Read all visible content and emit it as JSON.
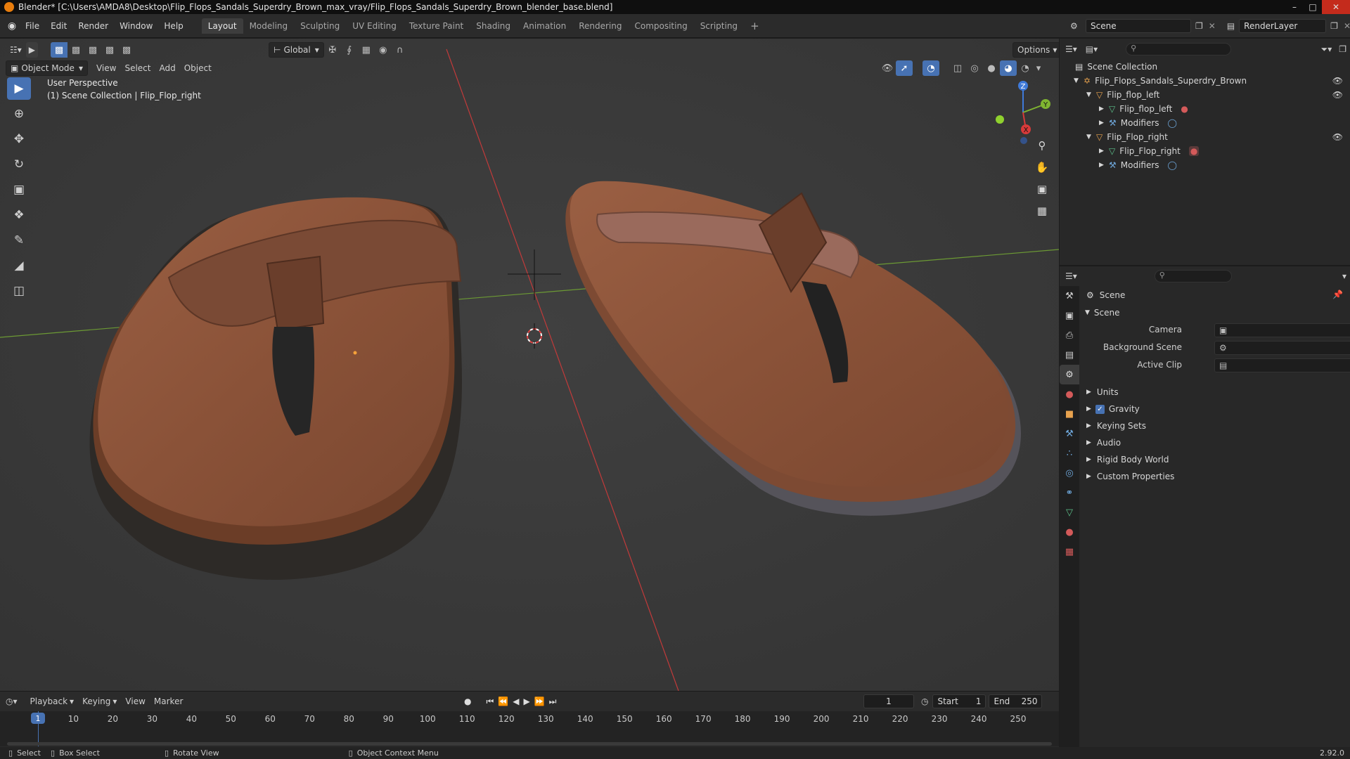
{
  "titlebar": {
    "text": "Blender* [C:\\Users\\AMDA8\\Desktop\\Flip_Flops_Sandals_Superdry_Brown_max_vray/Flip_Flops_Sandals_Superdry_Brown_blender_base.blend]"
  },
  "menus": [
    "File",
    "Edit",
    "Render",
    "Window",
    "Help"
  ],
  "workspaces": [
    "Layout",
    "Modeling",
    "Sculpting",
    "UV Editing",
    "Texture Paint",
    "Shading",
    "Animation",
    "Rendering",
    "Compositing",
    "Scripting"
  ],
  "scene": {
    "name": "Scene",
    "view_layer": "RenderLayer"
  },
  "header": {
    "transform": "Global",
    "options": "Options"
  },
  "viewport": {
    "mode": "Object Mode",
    "menus": [
      "View",
      "Select",
      "Add",
      "Object"
    ],
    "perspective": "User Perspective",
    "collection_info": "(1) Scene Collection | Flip_Flop_right",
    "axes": {
      "z": "Z",
      "y": "Y",
      "x": "X"
    }
  },
  "outliner": {
    "root": "Scene Collection",
    "items": [
      {
        "label": "Flip_Flops_Sandals_Superdry_Brown"
      },
      {
        "label": "Flip_flop_left"
      },
      {
        "label": "Flip_flop_left"
      },
      {
        "label": "Modifiers"
      },
      {
        "label": "Flip_Flop_right"
      },
      {
        "label": "Flip_Flop_right"
      },
      {
        "label": "Modifiers"
      }
    ]
  },
  "properties": {
    "context": "Scene",
    "panel": "Scene",
    "fields": [
      {
        "label": "Camera"
      },
      {
        "label": "Background Scene"
      },
      {
        "label": "Active Clip"
      }
    ],
    "sections": [
      "Units",
      "Gravity",
      "Keying Sets",
      "Audio",
      "Rigid Body World",
      "Custom Properties"
    ],
    "gravity_checked": true
  },
  "timeline": {
    "menus": [
      "Playback",
      "Keying",
      "View",
      "Marker"
    ],
    "current_frame": "1",
    "start_label": "Start",
    "start": "1",
    "end_label": "End",
    "end": "250",
    "ticks": [
      "1",
      "10",
      "20",
      "30",
      "40",
      "50",
      "60",
      "70",
      "80",
      "90",
      "100",
      "110",
      "120",
      "130",
      "140",
      "150",
      "160",
      "170",
      "180",
      "190",
      "200",
      "210",
      "220",
      "230",
      "240",
      "250"
    ]
  },
  "statusbar": {
    "select": "Select",
    "box_select": "Box Select",
    "rotate": "Rotate View",
    "context_menu": "Object Context Menu",
    "version": "2.92.0"
  },
  "colors": {
    "accent": "#4772b3",
    "orange": "#e87d0d",
    "x_axis": "#d83a3a",
    "y_axis": "#7fb531",
    "z_axis": "#3f7ad9",
    "sandal": "#8a5238"
  }
}
